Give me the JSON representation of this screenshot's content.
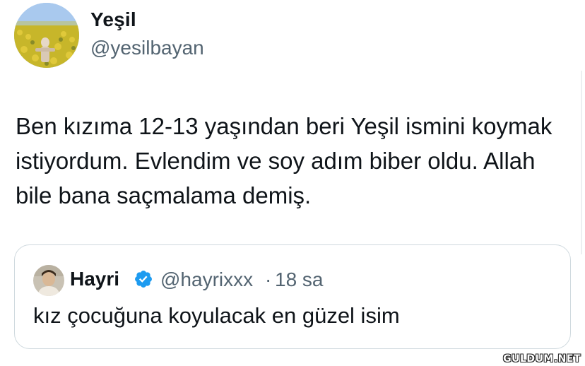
{
  "tweet": {
    "author": {
      "display_name": "Yeşil",
      "handle": "@yesilbayan"
    },
    "text": "Ben kızıma 12-13 yaşından beri Yeşil ismini koymak istiyordum. Evlendim ve soy adım biber oldu. Allah bile bana saçmalama demiş."
  },
  "quoted_tweet": {
    "author": {
      "display_name": "Hayri",
      "handle": "@hayrixxx",
      "verified": true
    },
    "separator": "·",
    "time": "18 sa",
    "text": "kız çocuğuna koyulacak en güzel isim"
  },
  "icons": {
    "avatar": "sunflower-field-photo",
    "quote_avatar": "person-photo",
    "verified": "verified-badge-icon"
  },
  "colors": {
    "text": "#0f1419",
    "secondary": "#536471",
    "verified": "#1d9bf0",
    "border": "#cfd9de"
  },
  "watermark": "GULDUM.NET"
}
